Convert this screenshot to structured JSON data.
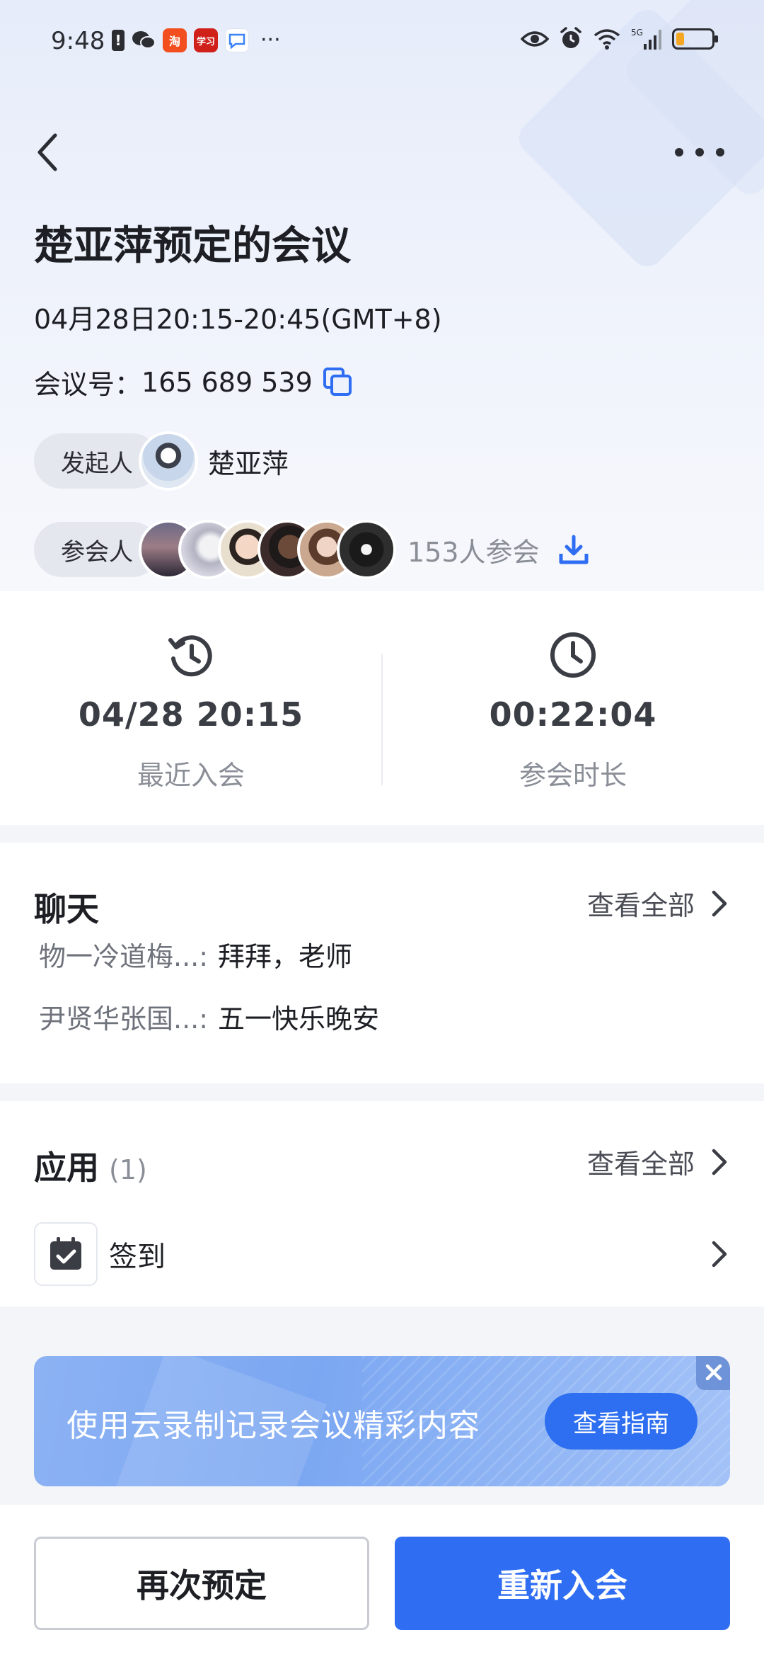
{
  "status_bar": {
    "time": "9:48",
    "apps": [
      {
        "name": "alert-icon",
        "text": "!",
        "color": "#2b2d33"
      },
      {
        "name": "wechat-icon",
        "text": "✦",
        "color": "#2b2d33"
      },
      {
        "name": "taobao-app-icon",
        "text": "淘",
        "color": "#f24e1e"
      },
      {
        "name": "xuexi-app-icon",
        "text": "学习",
        "color": "#d0201a"
      },
      {
        "name": "chat-bubble-app-icon",
        "text": "Q",
        "color": "#3b82f6"
      }
    ],
    "more": "···",
    "battery_level": 0.2
  },
  "meeting": {
    "title": "楚亚萍预定的会议",
    "datetime": "04月28日20:15-20:45(GMT+8)",
    "meeting_no_label": "会议号：",
    "meeting_no": "165 689 539",
    "host_label": "发起人",
    "host_name": "楚亚萍",
    "participants_label": "参会人",
    "participants_count_text": "153人参会"
  },
  "stats": {
    "last_join_value": "04/28 20:15",
    "last_join_label": "最近入会",
    "duration_value": "00:22:04",
    "duration_label": "参会时长"
  },
  "chat": {
    "title": "聊天",
    "view_all": "查看全部",
    "messages": [
      {
        "sender": "物一冷道梅...:",
        "text": "拜拜，老师"
      },
      {
        "sender": "尹贤华张国...:",
        "text": "五一快乐晚安"
      }
    ]
  },
  "apps": {
    "title": "应用",
    "count": "(1)",
    "view_all": "查看全部",
    "items": [
      {
        "label": "签到"
      }
    ]
  },
  "banner": {
    "text": "使用云录制记录会议精彩内容",
    "button": "查看指南"
  },
  "actions": {
    "rebook": "再次预定",
    "rejoin": "重新入会"
  },
  "colors": {
    "primary": "#2f6df3",
    "accent_icon": "#2f6df3"
  }
}
